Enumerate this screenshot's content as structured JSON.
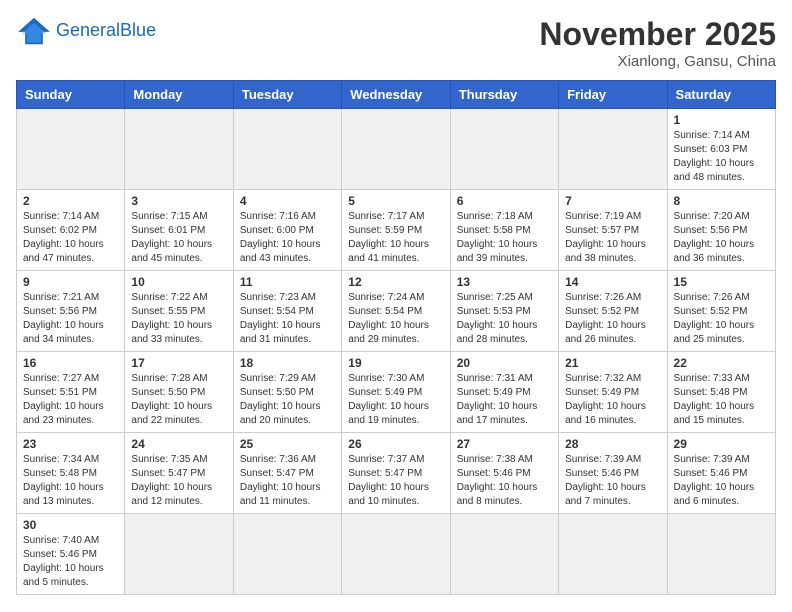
{
  "header": {
    "logo_general": "General",
    "logo_blue": "Blue",
    "month_title": "November 2025",
    "location": "Xianlong, Gansu, China"
  },
  "weekdays": [
    "Sunday",
    "Monday",
    "Tuesday",
    "Wednesday",
    "Thursday",
    "Friday",
    "Saturday"
  ],
  "weeks": [
    [
      {
        "day": "",
        "info": ""
      },
      {
        "day": "",
        "info": ""
      },
      {
        "day": "",
        "info": ""
      },
      {
        "day": "",
        "info": ""
      },
      {
        "day": "",
        "info": ""
      },
      {
        "day": "",
        "info": ""
      },
      {
        "day": "1",
        "info": "Sunrise: 7:14 AM\nSunset: 6:03 PM\nDaylight: 10 hours and 48 minutes."
      }
    ],
    [
      {
        "day": "2",
        "info": "Sunrise: 7:14 AM\nSunset: 6:02 PM\nDaylight: 10 hours and 47 minutes."
      },
      {
        "day": "3",
        "info": "Sunrise: 7:15 AM\nSunset: 6:01 PM\nDaylight: 10 hours and 45 minutes."
      },
      {
        "day": "4",
        "info": "Sunrise: 7:16 AM\nSunset: 6:00 PM\nDaylight: 10 hours and 43 minutes."
      },
      {
        "day": "5",
        "info": "Sunrise: 7:17 AM\nSunset: 5:59 PM\nDaylight: 10 hours and 41 minutes."
      },
      {
        "day": "6",
        "info": "Sunrise: 7:18 AM\nSunset: 5:58 PM\nDaylight: 10 hours and 39 minutes."
      },
      {
        "day": "7",
        "info": "Sunrise: 7:19 AM\nSunset: 5:57 PM\nDaylight: 10 hours and 38 minutes."
      },
      {
        "day": "8",
        "info": "Sunrise: 7:20 AM\nSunset: 5:56 PM\nDaylight: 10 hours and 36 minutes."
      }
    ],
    [
      {
        "day": "9",
        "info": "Sunrise: 7:21 AM\nSunset: 5:56 PM\nDaylight: 10 hours and 34 minutes."
      },
      {
        "day": "10",
        "info": "Sunrise: 7:22 AM\nSunset: 5:55 PM\nDaylight: 10 hours and 33 minutes."
      },
      {
        "day": "11",
        "info": "Sunrise: 7:23 AM\nSunset: 5:54 PM\nDaylight: 10 hours and 31 minutes."
      },
      {
        "day": "12",
        "info": "Sunrise: 7:24 AM\nSunset: 5:54 PM\nDaylight: 10 hours and 29 minutes."
      },
      {
        "day": "13",
        "info": "Sunrise: 7:25 AM\nSunset: 5:53 PM\nDaylight: 10 hours and 28 minutes."
      },
      {
        "day": "14",
        "info": "Sunrise: 7:26 AM\nSunset: 5:52 PM\nDaylight: 10 hours and 26 minutes."
      },
      {
        "day": "15",
        "info": "Sunrise: 7:26 AM\nSunset: 5:52 PM\nDaylight: 10 hours and 25 minutes."
      }
    ],
    [
      {
        "day": "16",
        "info": "Sunrise: 7:27 AM\nSunset: 5:51 PM\nDaylight: 10 hours and 23 minutes."
      },
      {
        "day": "17",
        "info": "Sunrise: 7:28 AM\nSunset: 5:50 PM\nDaylight: 10 hours and 22 minutes."
      },
      {
        "day": "18",
        "info": "Sunrise: 7:29 AM\nSunset: 5:50 PM\nDaylight: 10 hours and 20 minutes."
      },
      {
        "day": "19",
        "info": "Sunrise: 7:30 AM\nSunset: 5:49 PM\nDaylight: 10 hours and 19 minutes."
      },
      {
        "day": "20",
        "info": "Sunrise: 7:31 AM\nSunset: 5:49 PM\nDaylight: 10 hours and 17 minutes."
      },
      {
        "day": "21",
        "info": "Sunrise: 7:32 AM\nSunset: 5:49 PM\nDaylight: 10 hours and 16 minutes."
      },
      {
        "day": "22",
        "info": "Sunrise: 7:33 AM\nSunset: 5:48 PM\nDaylight: 10 hours and 15 minutes."
      }
    ],
    [
      {
        "day": "23",
        "info": "Sunrise: 7:34 AM\nSunset: 5:48 PM\nDaylight: 10 hours and 13 minutes."
      },
      {
        "day": "24",
        "info": "Sunrise: 7:35 AM\nSunset: 5:47 PM\nDaylight: 10 hours and 12 minutes."
      },
      {
        "day": "25",
        "info": "Sunrise: 7:36 AM\nSunset: 5:47 PM\nDaylight: 10 hours and 11 minutes."
      },
      {
        "day": "26",
        "info": "Sunrise: 7:37 AM\nSunset: 5:47 PM\nDaylight: 10 hours and 10 minutes."
      },
      {
        "day": "27",
        "info": "Sunrise: 7:38 AM\nSunset: 5:46 PM\nDaylight: 10 hours and 8 minutes."
      },
      {
        "day": "28",
        "info": "Sunrise: 7:39 AM\nSunset: 5:46 PM\nDaylight: 10 hours and 7 minutes."
      },
      {
        "day": "29",
        "info": "Sunrise: 7:39 AM\nSunset: 5:46 PM\nDaylight: 10 hours and 6 minutes."
      }
    ],
    [
      {
        "day": "30",
        "info": "Sunrise: 7:40 AM\nSunset: 5:46 PM\nDaylight: 10 hours and 5 minutes."
      },
      {
        "day": "",
        "info": ""
      },
      {
        "day": "",
        "info": ""
      },
      {
        "day": "",
        "info": ""
      },
      {
        "day": "",
        "info": ""
      },
      {
        "day": "",
        "info": ""
      },
      {
        "day": "",
        "info": ""
      }
    ]
  ]
}
